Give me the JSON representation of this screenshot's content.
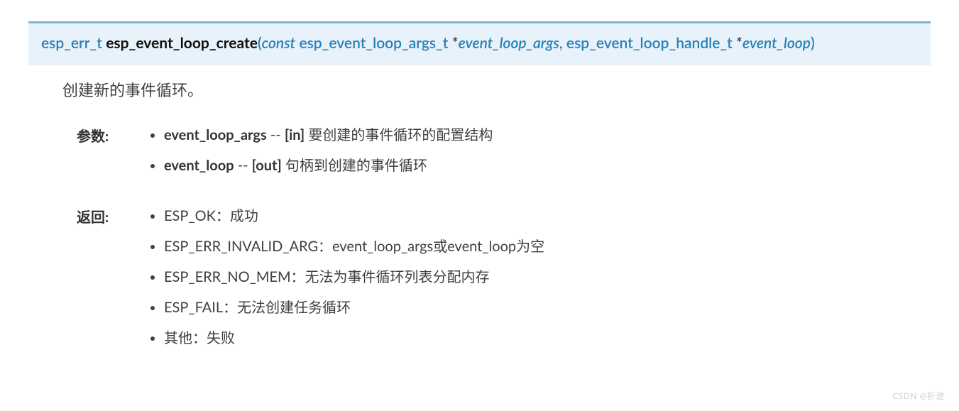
{
  "signature": {
    "return_type": "esp_err_t",
    "function_name": "esp_event_loop_create",
    "params": [
      {
        "keyword": "const",
        "type": "esp_event_loop_args_t",
        "name": "event_loop_args"
      },
      {
        "keyword": "",
        "type": "esp_event_loop_handle_t",
        "name": "event_loop"
      }
    ]
  },
  "brief": "创建新的事件循环。",
  "params_label": "参数:",
  "params": [
    {
      "name": "event_loop_args",
      "dir": "[in]",
      "desc": "要创建的事件循环的配置结构"
    },
    {
      "name": "event_loop",
      "dir": "[out]",
      "desc": "句柄到创建的事件循环"
    }
  ],
  "returns_label": "返回:",
  "returns": [
    "ESP_OK：成功",
    "ESP_ERR_INVALID_ARG：event_loop_args或event_loop为空",
    "ESP_ERR_NO_MEM：无法为事件循环列表分配内存",
    "ESP_FAIL：无法创建任务循环",
    "其他：失败"
  ],
  "watermark": "CSDN @折途"
}
